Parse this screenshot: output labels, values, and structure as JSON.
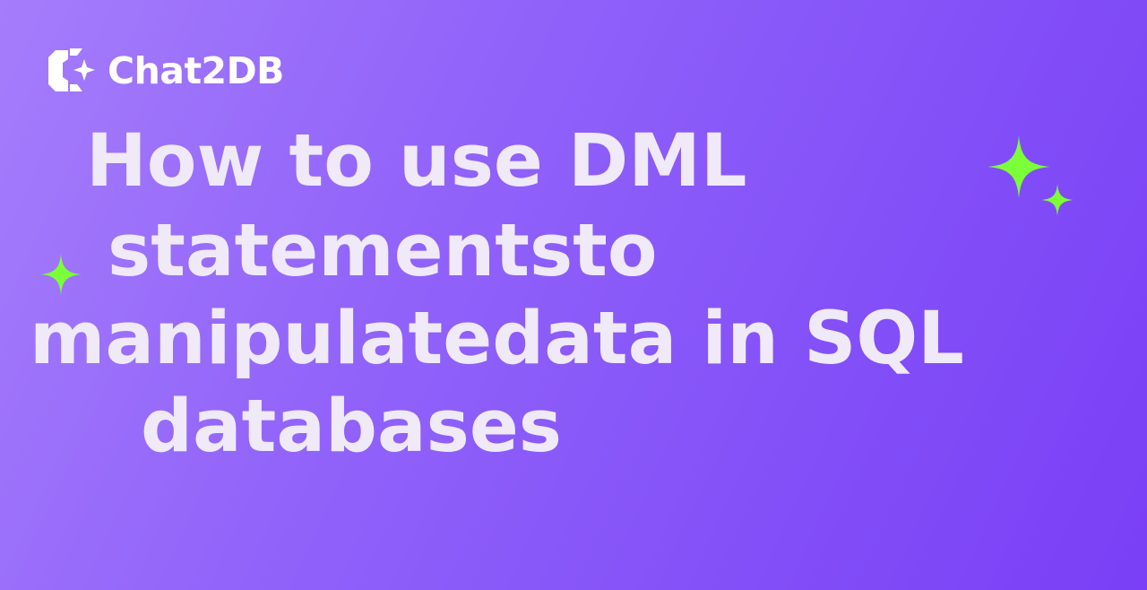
{
  "brand": {
    "name": "Chat2DB",
    "logo_icon": "chat2db-logo-mark"
  },
  "headline": {
    "lines": [
      "How to use DML",
      "statementsto",
      "manipulatedata in SQL",
      "databases"
    ]
  },
  "decorations": {
    "sparkle_icon": "four-point-sparkle-icon",
    "sparkle_color": "#7bff38"
  },
  "colors": {
    "background_start": "#a57dfb",
    "background_end": "#7a3ff6",
    "headline_text": "#efe9f8",
    "logo_text": "#ffffff"
  }
}
